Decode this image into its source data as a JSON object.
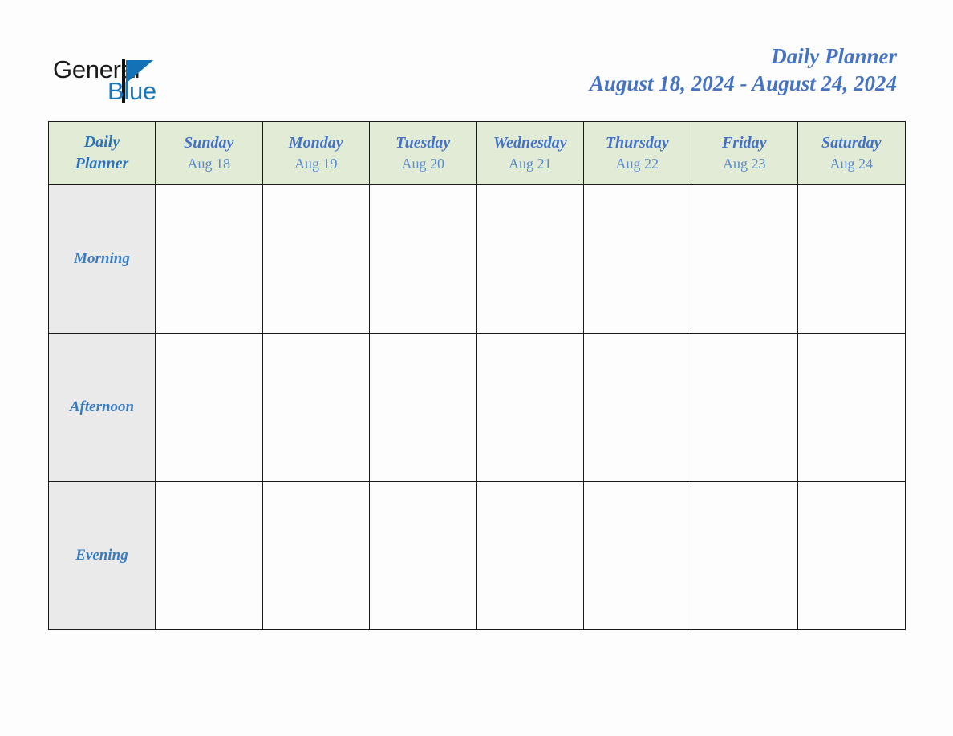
{
  "document": {
    "title": "Daily Planner",
    "date_range": "August 18, 2024 - August 24, 2024"
  },
  "brand": {
    "name_part1": "General",
    "name_part2": "Blue",
    "logo_icon": "triangle-flag-icon",
    "color_dark": "#1a1a1a",
    "color_blue": "#1878bd"
  },
  "colors": {
    "header_background": "#e2ebd5",
    "row_label_background": "#eaeaea",
    "accent_blue": "#4472c4",
    "label_blue": "#3a7cc0",
    "date_blue": "#5b8bcd",
    "border": "#1a1a1a",
    "page_background": "#fdfdfd"
  },
  "table": {
    "corner_label_line1": "Daily",
    "corner_label_line2": "Planner",
    "columns": [
      {
        "day": "Sunday",
        "date": "Aug 18"
      },
      {
        "day": "Monday",
        "date": "Aug 19"
      },
      {
        "day": "Tuesday",
        "date": "Aug 20"
      },
      {
        "day": "Wednesday",
        "date": "Aug 21"
      },
      {
        "day": "Thursday",
        "date": "Aug 22"
      },
      {
        "day": "Friday",
        "date": "Aug 23"
      },
      {
        "day": "Saturday",
        "date": "Aug 24"
      }
    ],
    "rows": [
      {
        "label": "Morning",
        "cells": [
          "",
          "",
          "",
          "",
          "",
          "",
          ""
        ]
      },
      {
        "label": "Afternoon",
        "cells": [
          "",
          "",
          "",
          "",
          "",
          "",
          ""
        ]
      },
      {
        "label": "Evening",
        "cells": [
          "",
          "",
          "",
          "",
          "",
          "",
          ""
        ]
      }
    ]
  }
}
